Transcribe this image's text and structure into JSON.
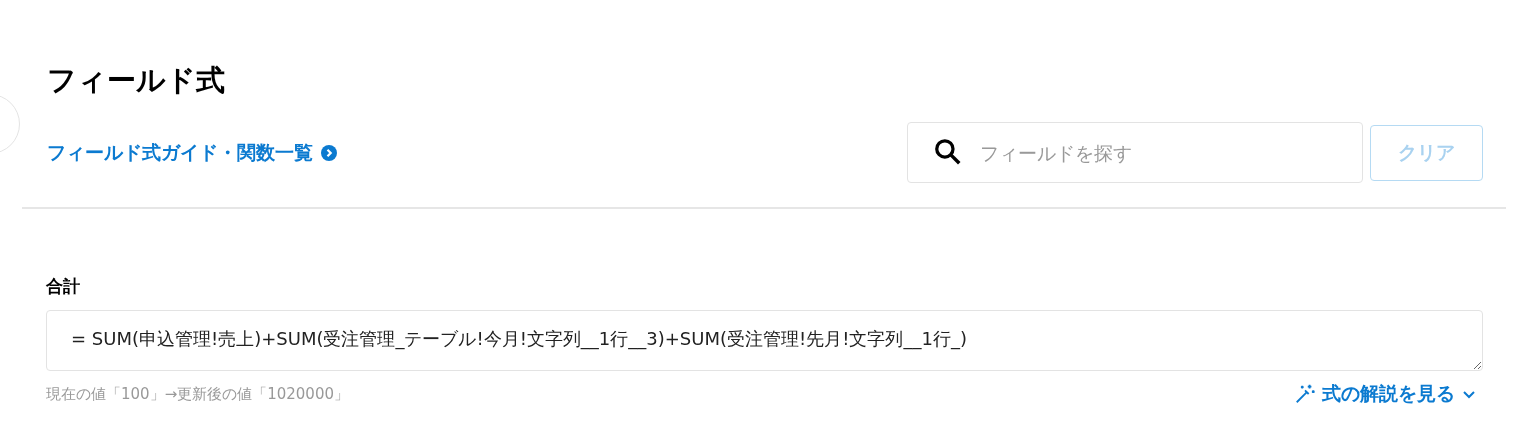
{
  "title": "フィールド式",
  "guide_link": "フィールド式ガイド・関数一覧",
  "search": {
    "placeholder": "フィールドを探す"
  },
  "clear_button": {
    "label": "クリア",
    "disabled": true
  },
  "field": {
    "label": "合計",
    "value": "= SUM(申込管理!売上)+SUM(受注管理_テーブル!今月!文字列__1行__3)+SUM(受注管理!先月!文字列__1行_)",
    "hint": "現在の値「100」→更新後の値「1020000」"
  },
  "explain": {
    "label": "式の解説を見る",
    "expanded": false
  }
}
